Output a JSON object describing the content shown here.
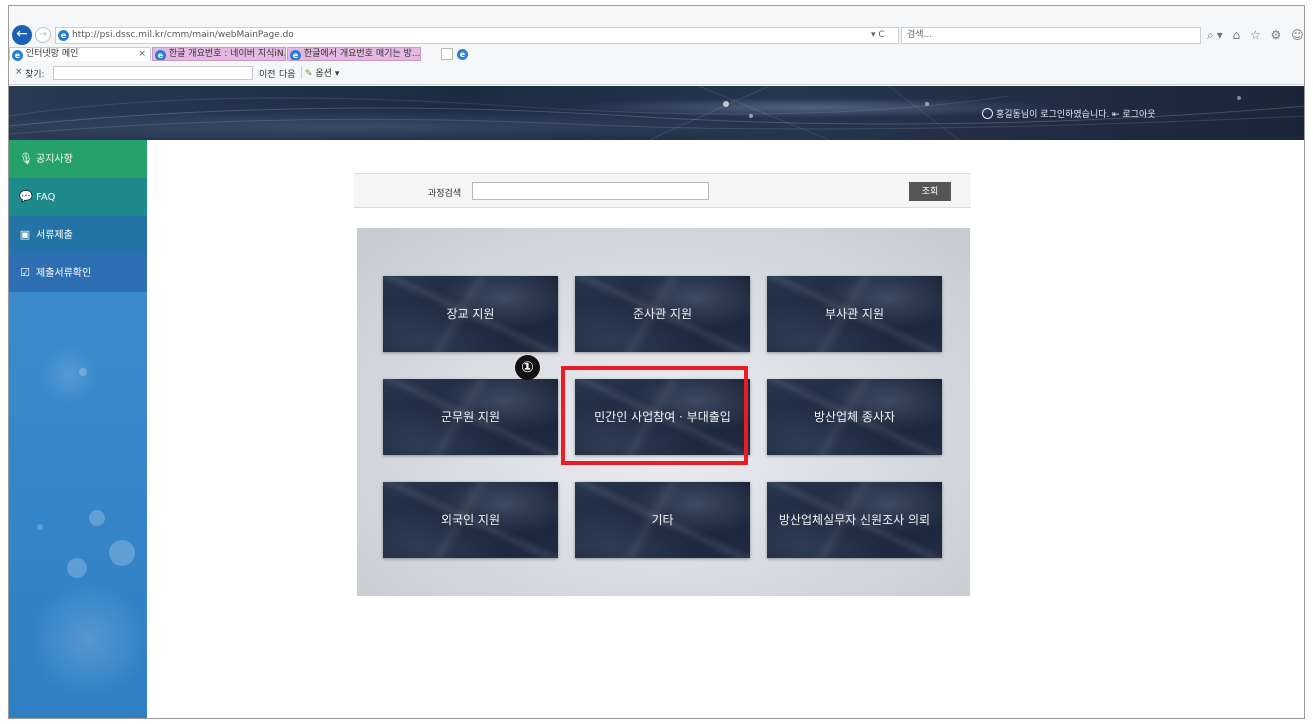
{
  "browser": {
    "url": "http://psi.dssc.mil.kr/cmm/main/webMainPage.do",
    "url_controls": "▾ C",
    "search_placeholder": "검색...",
    "right_icons": "⌕▾ ⌂ ☆ ⚙ ☺",
    "window_controls": "– ❐ ✕",
    "tabs": [
      {
        "label": "인터넷망 메인",
        "active": true
      },
      {
        "label": "한글 개요번호 : 네이버 지식iN...",
        "active": false
      },
      {
        "label": "한글에서 개요번호 매기는 방...",
        "active": false
      }
    ],
    "find_bar": {
      "close": "×",
      "label": "찾기:",
      "value": "",
      "prev": "이전",
      "next": "다음",
      "options": "옵션 ▾"
    }
  },
  "header": {
    "user_text": "홍길동님이 로그인하였습니다.",
    "logout_label": "로그아웃"
  },
  "sidebar": {
    "items": [
      {
        "label": "공지사항",
        "icon": "microphone-icon",
        "color": "#26a16a"
      },
      {
        "label": "FAQ",
        "icon": "chat-icon",
        "color": "#1f8a8c"
      },
      {
        "label": "서류제출",
        "icon": "document-submit-icon",
        "color": "#2373a6"
      },
      {
        "label": "제출서류확인",
        "icon": "checklist-icon",
        "color": "#2d6fb2"
      }
    ]
  },
  "search": {
    "label": "과정검색",
    "value": "",
    "button_label": "조회"
  },
  "tiles": [
    "장교 지원",
    "준사관 지원",
    "부사관 지원",
    "군무원 지원",
    "민간인 사업참여 · 부대출입",
    "방산업체 종사자",
    "외국인 지원",
    "기타",
    "방산업체실무자 신원조사 의뢰"
  ],
  "annotation": {
    "marker_label": "①",
    "highlight_color": "#ec1c24"
  }
}
